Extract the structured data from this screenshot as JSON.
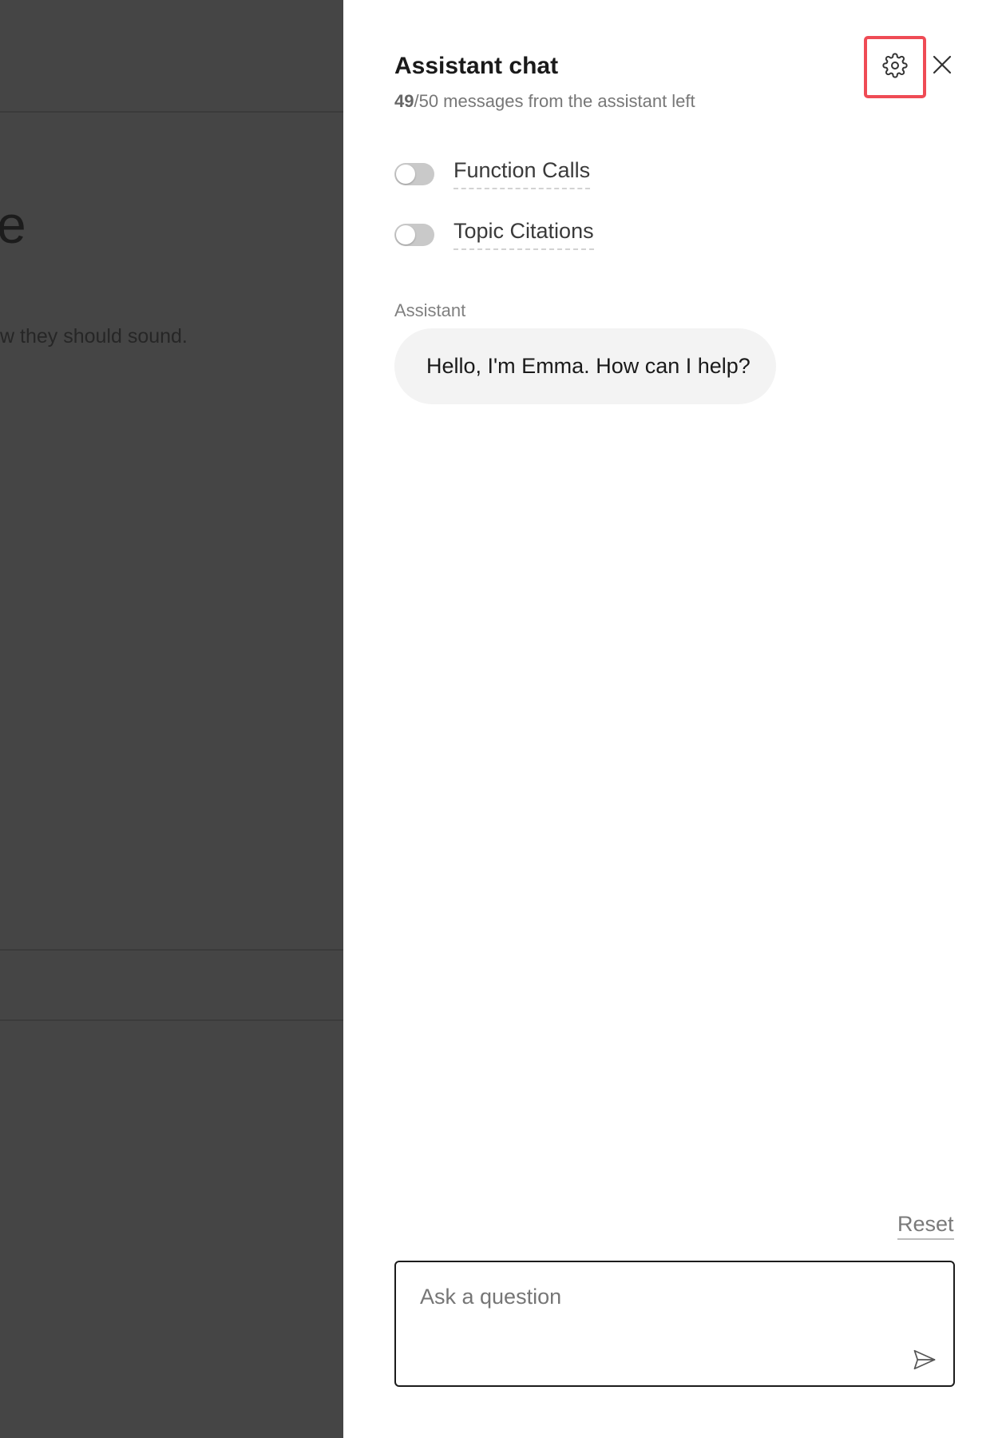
{
  "background_page": {
    "heading_fragment": "e",
    "text_fragment": "w they should sound."
  },
  "assistant_panel": {
    "title": "Assistant chat",
    "quota": {
      "used": "49",
      "rest": "/50 messages from the assistant left"
    },
    "header_icons": [
      "gear-icon",
      "close-icon"
    ],
    "toggles": [
      {
        "label": "Function Calls",
        "enabled": false
      },
      {
        "label": "Topic Citations",
        "enabled": false
      }
    ],
    "messages": [
      {
        "sender": "Assistant",
        "text": "Hello, I'm Emma. How can I help?"
      }
    ],
    "reset_label": "Reset",
    "input": {
      "placeholder": "Ask a question",
      "value": "",
      "send_icon": "send-icon"
    },
    "colors": {
      "highlight_border": "#ef4b55",
      "overlay": "#454545",
      "bubble": "#f3f3f3",
      "toggle_off": "#c9c9c9"
    }
  }
}
